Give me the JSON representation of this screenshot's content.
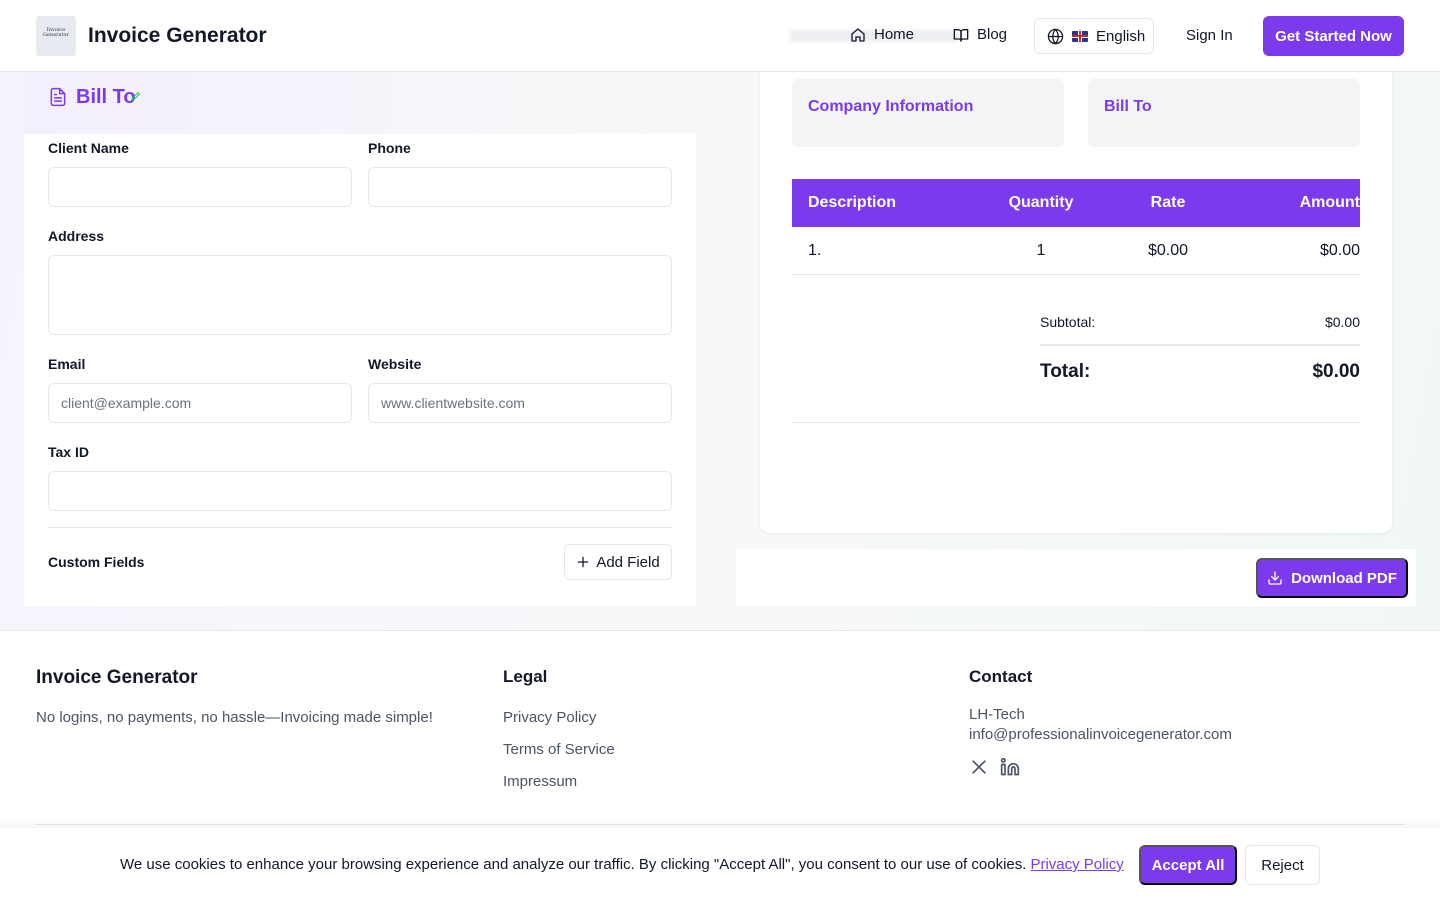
{
  "colors": {
    "accent": "#7c3aed",
    "border": "#e5e7eb",
    "muted_text": "#4b5563"
  },
  "header": {
    "logo_text": "Invoice Generator",
    "brand": "Invoice Generator",
    "nav": {
      "home": "Home",
      "blog": "Blog"
    },
    "language": "English",
    "sign_in": "Sign In",
    "cta": "Get Started Now"
  },
  "form": {
    "section_title": "Bill To",
    "client_name": {
      "label": "Client Name",
      "value": "",
      "placeholder": ""
    },
    "phone": {
      "label": "Phone",
      "value": "",
      "placeholder": ""
    },
    "address": {
      "label": "Address",
      "value": "",
      "placeholder": ""
    },
    "email": {
      "label": "Email",
      "value": "",
      "placeholder": "client@example.com"
    },
    "website": {
      "label": "Website",
      "value": "",
      "placeholder": "www.clientwebsite.com"
    },
    "tax_id": {
      "label": "Tax ID",
      "value": "",
      "placeholder": ""
    },
    "custom_fields_label": "Custom Fields",
    "add_field": "Add Field"
  },
  "preview": {
    "company_info_title": "Company Information",
    "bill_to_title": "Bill To",
    "table": {
      "headers": [
        "Description",
        "Quantity",
        "Rate",
        "Amount"
      ],
      "rows": [
        {
          "index": "1.",
          "quantity": "1",
          "rate": "$0.00",
          "amount": "$0.00"
        }
      ]
    },
    "subtotal_label": "Subtotal:",
    "subtotal": "$0.00",
    "total_label": "Total:",
    "total": "$0.00",
    "download": "Download PDF"
  },
  "footer": {
    "brand": "Invoice Generator",
    "tagline": "No logins, no payments, no hassle—Invoicing made simple!",
    "legal": {
      "title": "Legal",
      "links": [
        "Privacy Policy",
        "Terms of Service",
        "Impressum"
      ]
    },
    "contact": {
      "title": "Contact",
      "company": "LH-Tech",
      "email": "info@professionalinvoicegenerator.com",
      "social": [
        "x-icon",
        "linkedin-icon"
      ]
    }
  },
  "cookie": {
    "message": "We use cookies to enhance your browsing experience and analyze our traffic. By clicking \"Accept All\", you consent to our use of cookies.",
    "link": "Privacy Policy",
    "accept": "Accept All",
    "reject": "Reject"
  }
}
